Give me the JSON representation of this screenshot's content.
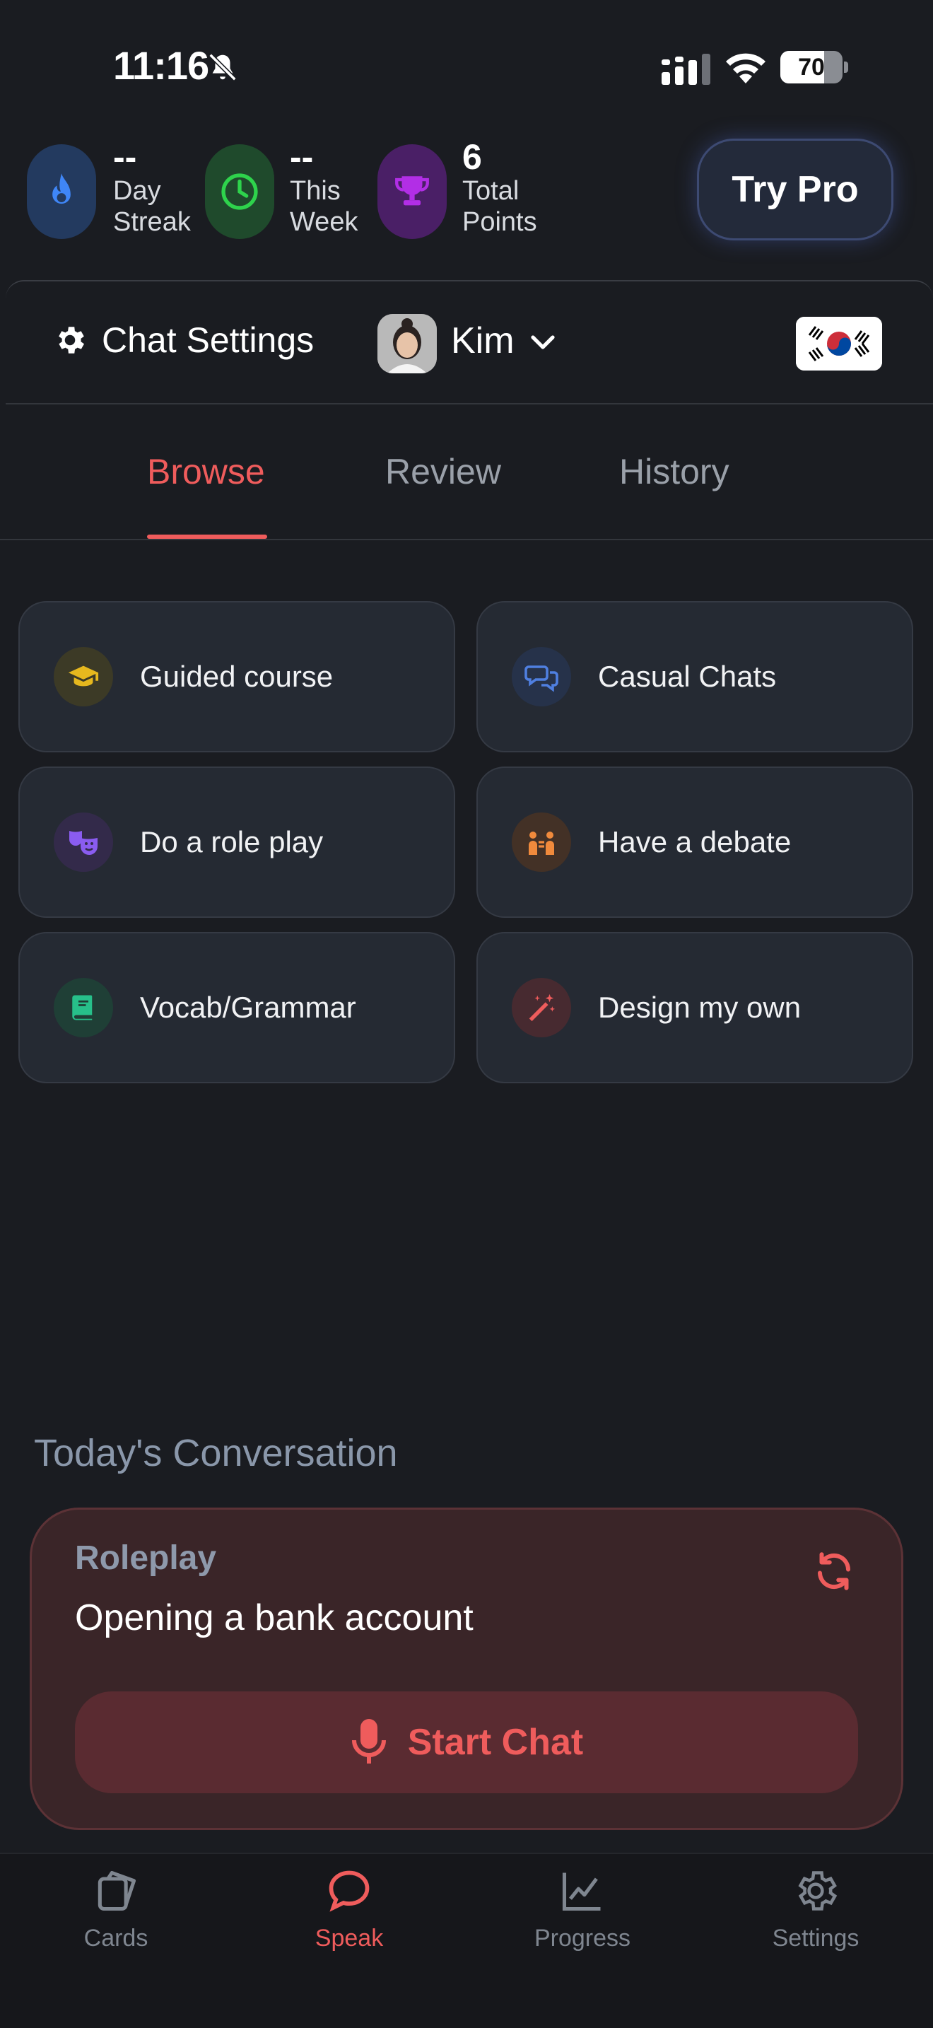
{
  "status_bar": {
    "time": "11:16",
    "battery_level": 70,
    "battery_label": "70"
  },
  "stats": {
    "streak": {
      "value": "--",
      "label_line1": "Day",
      "label_line2": "Streak",
      "icon": "flame-icon",
      "color": "#3f86f7"
    },
    "week": {
      "value": "--",
      "label_line1": "This",
      "label_line2": "Week",
      "icon": "clock-icon",
      "color": "#2ed34c"
    },
    "points": {
      "value": "6",
      "label_line1": "Total",
      "label_line2": "Points",
      "icon": "trophy-icon",
      "color": "#b22ee6"
    }
  },
  "header": {
    "try_pro_label": "Try Pro"
  },
  "chat_settings": {
    "label": "Chat Settings",
    "tutor_name": "Kim",
    "language_flag": "south-korea-flag"
  },
  "tabs": [
    {
      "label": "Browse",
      "active": true
    },
    {
      "label": "Review",
      "active": false
    },
    {
      "label": "History",
      "active": false
    }
  ],
  "options": [
    {
      "label": "Guided course",
      "icon": "graduation-cap-icon",
      "color": "#e6b81e"
    },
    {
      "label": "Casual Chats",
      "icon": "chat-bubbles-icon",
      "color": "#4f7fe0"
    },
    {
      "label": "Do a role play",
      "icon": "theater-masks-icon",
      "color": "#8a5cf0"
    },
    {
      "label": "Have a debate",
      "icon": "people-arguing-icon",
      "color": "#f08a3c"
    },
    {
      "label": "Vocab/Grammar",
      "icon": "book-icon",
      "color": "#27c08a"
    },
    {
      "label": "Design my own",
      "icon": "magic-wand-icon",
      "color": "#ef5c5c"
    }
  ],
  "today": {
    "title": "Today's Conversation",
    "type": "Roleplay",
    "topic": "Opening a bank account",
    "start_label": "Start Chat"
  },
  "bottom_nav": [
    {
      "label": "Cards",
      "icon": "cards-icon",
      "active": false
    },
    {
      "label": "Speak",
      "icon": "speech-bubble-icon",
      "active": true
    },
    {
      "label": "Progress",
      "icon": "line-chart-icon",
      "active": false
    },
    {
      "label": "Settings",
      "icon": "gear-icon",
      "active": false
    }
  ]
}
